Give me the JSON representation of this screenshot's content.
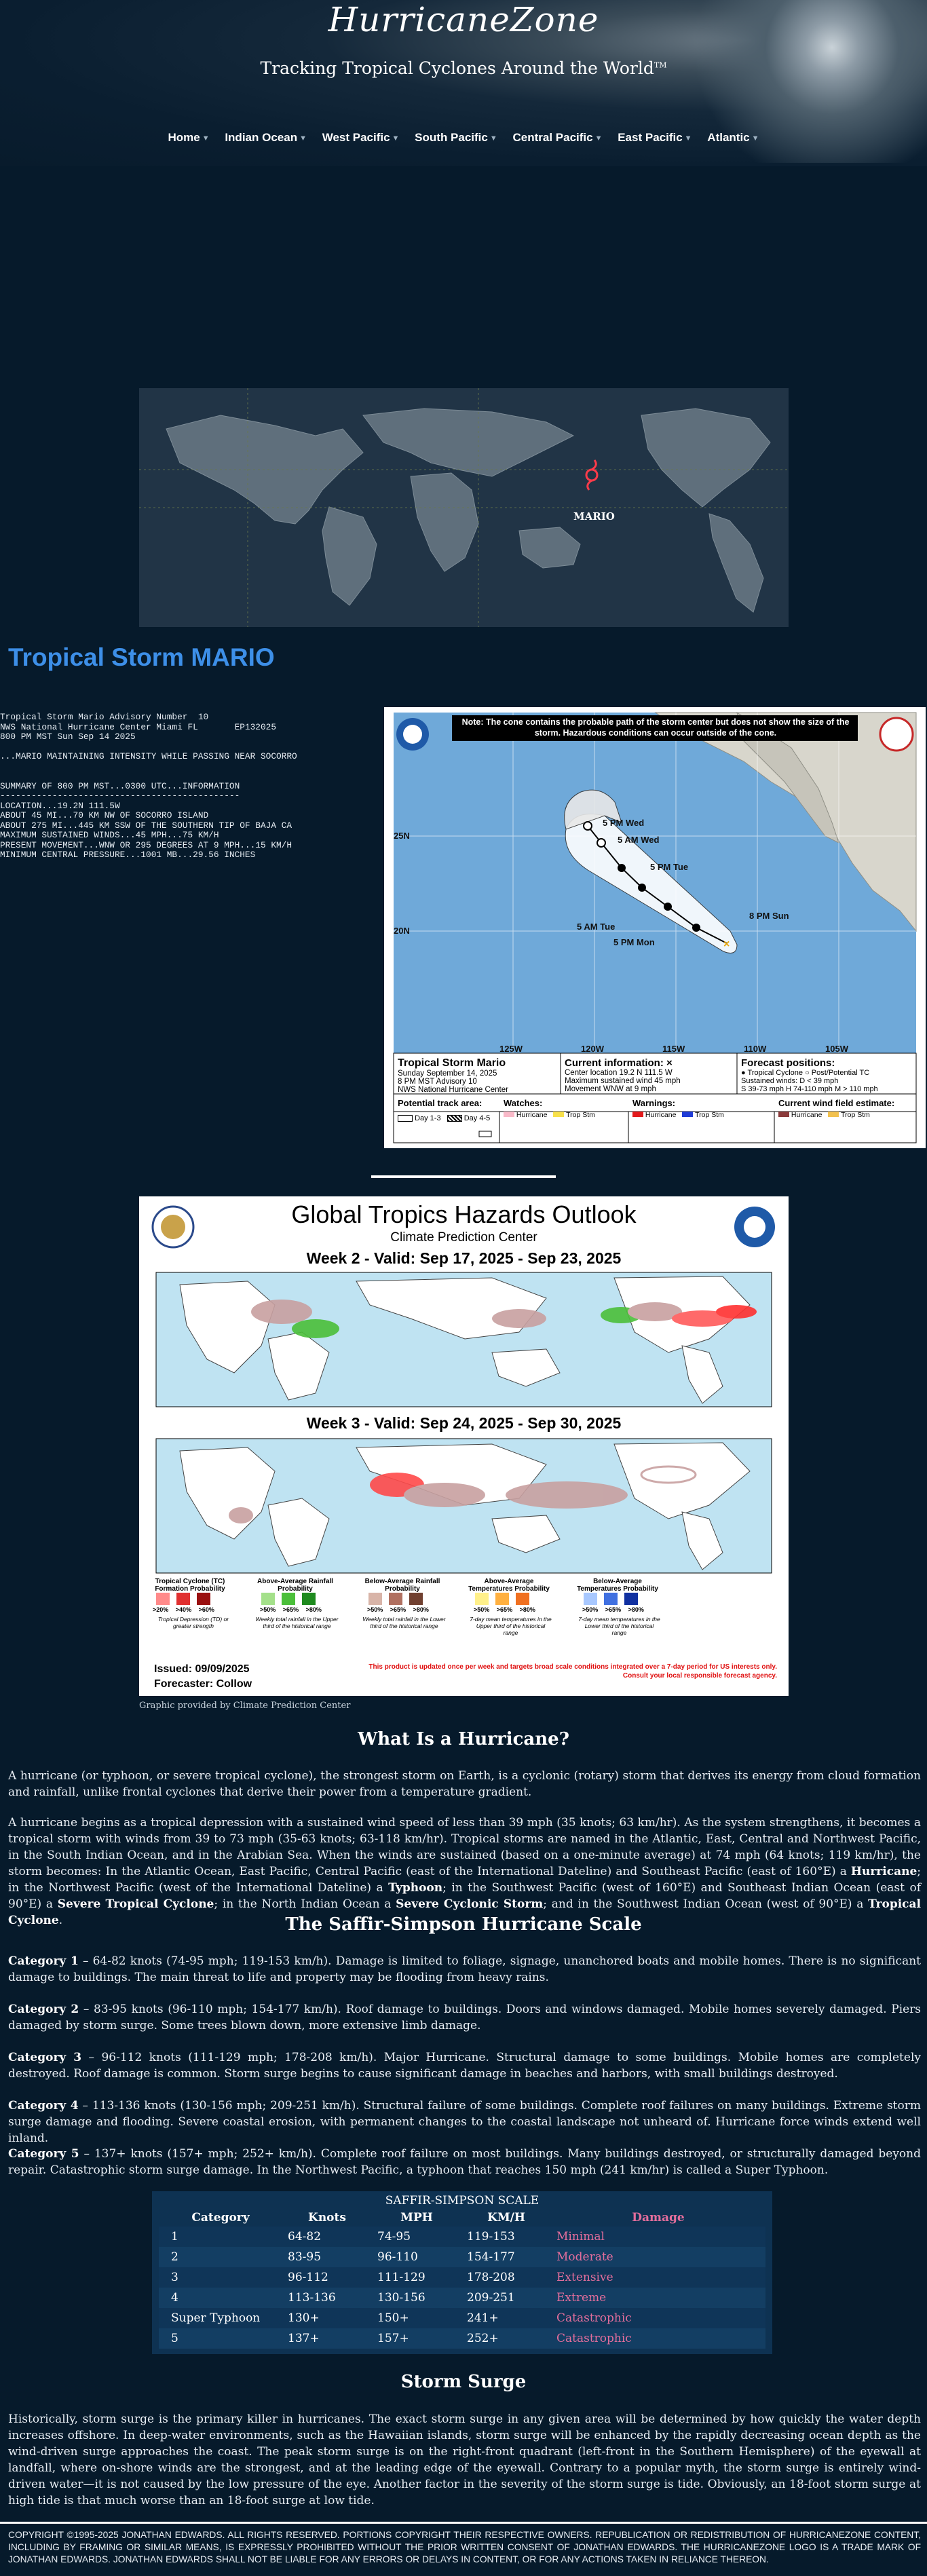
{
  "header": {
    "site_title": "HurricaneZone",
    "tagline": "Tracking Tropical Cyclones Around the World",
    "tagline_mark": "TM",
    "nav": [
      "Home",
      "Indian Ocean",
      "West Pacific",
      "South Pacific",
      "Central Pacific",
      "East Pacific",
      "Atlantic"
    ]
  },
  "world_map": {
    "storm_label": "MARIO"
  },
  "storm": {
    "title": "Tropical Storm MARIO",
    "advisory_text": "Tropical Storm Mario Advisory Number  10\nNWS National Hurricane Center Miami FL       EP132025\n800 PM MST Sun Sep 14 2025\n\n...MARIO MAINTAINING INTENSITY WHILE PASSING NEAR SOCORRO\n\n\nSUMMARY OF 800 PM MST...0300 UTC...INFORMATION\n----------------------------------------------\nLOCATION...19.2N 111.5W\nABOUT 45 MI...70 KM NW OF SOCORRO ISLAND\nABOUT 275 MI...445 KM SSW OF THE SOUTHERN TIP OF BAJA CA\nMAXIMUM SUSTAINED WINDS...45 MPH...75 KM/H\nPRESENT MOVEMENT...WNW OR 295 DEGREES AT 9 MPH...15 KM/H\nMINIMUM CENTRAL PRESSURE...1001 MB...29.56 INCHES"
  },
  "cone": {
    "note": "Note: The cone contains the probable path of the storm center but does not show the size of the storm. Hazardous conditions can occur outside of the cone.",
    "forecast_labels": [
      "5 PM Wed",
      "5 AM Wed",
      "5 PM Tue",
      "5 AM Tue",
      "5 PM Mon",
      "8 PM Sun"
    ],
    "lat_labels": [
      "25N",
      "20N"
    ],
    "lon_labels": [
      "125W",
      "120W",
      "115W",
      "110W",
      "105W"
    ],
    "storm_name": "Tropical Storm Mario",
    "date_line": "Sunday September 14, 2025",
    "advisory_line": "8 PM MST Advisory 10",
    "center_line": "NWS National Hurricane Center",
    "current_info_title": "Current information: ×",
    "current_info_lines": [
      "Center location 19.2 N 111.5 W",
      "Maximum sustained wind 45 mph",
      "Movement WNW at 9 mph"
    ],
    "forecast_positions_title": "Forecast positions:",
    "forecast_positions_lines": [
      "● Tropical Cyclone  ○ Post/Potential TC",
      "Sustained winds:      D < 39 mph",
      "S 39-73 mph  H 74-110 mph  M > 110 mph"
    ],
    "track_area_title": "Potential track area:",
    "track_area_items": [
      "Day 1-3",
      "Day 4-5"
    ],
    "watches_title": "Watches:",
    "watches_items": [
      "Hurricane",
      "Trop Stm"
    ],
    "warnings_title": "Warnings:",
    "warnings_items": [
      "Hurricane",
      "Trop Stm"
    ],
    "wind_field_title": "Current wind field estimate:",
    "wind_field_items": [
      "Hurricane",
      "Trop Stm"
    ]
  },
  "hazards": {
    "title": "Global Tropics Hazards Outlook",
    "subtitle": "Climate Prediction Center",
    "week2": "Week 2 - Valid: Sep 17, 2025 - Sep 23, 2025",
    "week3": "Week 3 - Valid: Sep 24, 2025 - Sep 30, 2025",
    "legend": [
      {
        "title": "Tropical Cyclone (TC) Formation Probability",
        "levels": [
          ">20%",
          ">40%",
          ">60%"
        ],
        "note": "Tropical Depression (TD) or greater strength"
      },
      {
        "title": "Above-Average Rainfall Probability",
        "levels": [
          ">50%",
          ">65%",
          ">80%"
        ],
        "note": "Weekly total rainfall in the Upper third of the historical range"
      },
      {
        "title": "Below-Average Rainfall Probability",
        "levels": [
          ">50%",
          ">65%",
          ">80%"
        ],
        "note": "Weekly total rainfall in the Lower third of the historical range"
      },
      {
        "title": "Above-Average Temperatures Probability",
        "levels": [
          ">50%",
          ">65%",
          ">80%"
        ],
        "note": "7-day mean temperatures in the Upper third of the historical range"
      },
      {
        "title": "Below-Average Temperatures Probability",
        "levels": [
          ">50%",
          ">65%",
          ">80%"
        ],
        "note": "7-day mean temperatures in the Lower third of the historical range"
      }
    ],
    "issued": "Issued: 09/09/2025",
    "forecaster": "Forecaster: Collow",
    "disclaimer_1": "This product is updated once per week and targets broad scale conditions integrated over a 7-day period for US interests only.",
    "disclaimer_2": "Consult your local responsible forecast agency.",
    "credit": "Graphic provided by Climate Prediction Center"
  },
  "article": {
    "what_title": "What Is a Hurricane?",
    "what_p1": "A hurricane (or typhoon, or severe tropical cyclone), the strongest storm on Earth, is a cyclonic (rotary) storm that derives its energy from cloud formation and rainfall, unlike frontal cyclones that derive their power from a temperature gradient.",
    "what_p2_a": "A hurricane begins as a tropical depression with a sustained wind speed of less than 39 mph (35 knots; 63 km/hr). As the system strengthens, it becomes a tropical storm with winds from 39 to 73 mph (35-63 knots; 63-118 km/hr). Tropical storms are named in the Atlantic, East, Central and Northwest Pacific, in the South Indian Ocean, and in the Arabian Sea. When the winds are sustained (based on a one-minute average) at 74 mph (64 knots; 119 km/hr), the storm becomes: In the Atlantic Ocean, East Pacific, Central Pacific (east of the International Dateline) and Southeast Pacific (east of 160°E) a",
    "what_p2_b1": "Hurricane",
    "what_p2_c": "; in the Northwest Pacific (west of the International Dateline) a",
    "what_p2_b2": "Typhoon",
    "what_p2_d": "; in the Southwest Pacific (west of 160°E) and Southeast Indian Ocean (east of 90°E) a",
    "what_p2_b3": "Severe Tropical Cyclone",
    "what_p2_e": "; in the North Indian Ocean a",
    "what_p2_b4": "Severe Cyclonic Storm",
    "what_p2_f": "; and in the Southwest Indian Ocean (west of 90°E) a",
    "what_p2_b5": "Tropical Cyclone",
    "what_p2_g": ".",
    "ss_title": "The Saffir-Simpson Hurricane Scale",
    "categories": [
      {
        "label": "Category 1",
        "text": " – 64-82 knots (74-95 mph; 119-153 km/h). Damage is limited to foliage, signage, unanchored boats and mobile homes. There is no significant damage to buildings. The main threat to life and property may be flooding from heavy rains."
      },
      {
        "label": "Category 2",
        "text": " – 83-95 knots (96-110 mph; 154-177 km/h). Roof damage to buildings. Doors and windows damaged. Mobile homes severely damaged. Piers damaged by storm surge. Some trees blown down, more extensive limb damage."
      },
      {
        "label": "Category 3",
        "text": " – 96-112 knots (111-129 mph; 178-208 km/h). Major Hurricane. Structural damage to some buildings. Mobile homes are completely destroyed. Roof damage is common. Storm surge begins to cause significant damage in beaches and harbors, with small buildings destroyed."
      },
      {
        "label": "Category 4",
        "text": " – 113-136 knots (130-156 mph; 209-251 km/h). Structural failure of some buildings. Complete roof failures on many buildings. Extreme storm surge damage and flooding. Severe coastal erosion, with permanent changes to the coastal landscape not unheard of. Hurricane force winds extend well inland."
      },
      {
        "label": "Category 5",
        "text": " – 137+ knots (157+ mph; 252+ km/h). Complete roof failure on most buildings. Many buildings destroyed, or structurally damaged beyond repair. Catastrophic storm surge damage. In the Northwest Pacific, a typhoon that reaches 150 mph (241 km/hr) is called a Super Typhoon."
      }
    ],
    "table": {
      "caption": "SAFFIR-SIMPSON SCALE",
      "headers": [
        "Category",
        "Knots",
        "MPH",
        "KM/H",
        "Damage"
      ],
      "rows": [
        [
          "1",
          "64-82",
          "74-95",
          "119-153",
          "Minimal"
        ],
        [
          "2",
          "83-95",
          "96-110",
          "154-177",
          "Moderate"
        ],
        [
          "3",
          "96-112",
          "111-129",
          "178-208",
          "Extensive"
        ],
        [
          "4",
          "113-136",
          "130-156",
          "209-251",
          "Extreme"
        ],
        [
          "Super Typhoon",
          "130+",
          "150+",
          "241+",
          "Catastrophic"
        ],
        [
          "5",
          "137+",
          "157+",
          "252+",
          "Catastrophic"
        ]
      ]
    },
    "surge_title": "Storm Surge",
    "surge_p": "Historically, storm surge is the primary killer in hurricanes. The exact storm surge in any given area will be determined by how quickly the water depth increases offshore. In deep-water environments, such as the Hawaiian islands, storm surge will be enhanced by the rapidly decreasing ocean depth as the wind-driven surge approaches the coast. The peak storm surge is on the right-front quadrant (left-front in the Southern Hemisphere) of the eyewall at landfall, where on-shore winds are the strongest, and at the leading edge of the eyewall. Contrary to a popular myth, the storm surge is entirely wind-driven water—it is not caused by the low pressure of the eye. Another factor in the severity of the storm surge is tide. Obviously, an 18-foot storm surge at high tide is that much worse than an 18-foot surge at low tide."
  },
  "footer": {
    "text": "COPYRIGHT ©1995-2025 JONATHAN EDWARDS. ALL RIGHTS RESERVED. PORTIONS COPYRIGHT THEIR RESPECTIVE OWNERS. REPUBLICATION OR REDISTRIBUTION OF HURRICANEZONE CONTENT, INCLUDING BY FRAMING OR SIMILAR MEANS, IS EXPRESSLY PROHIBITED WITHOUT THE PRIOR WRITTEN CONSENT OF JONATHAN EDWARDS. THE HURRICANEZONE LOGO IS A TRADE MARK OF JONATHAN EDWARDS. JONATHAN EDWARDS SHALL NOT BE LIABLE FOR ANY ERRORS OR DELAYS IN CONTENT, OR FOR ANY ACTIONS TAKEN IN RELIANCE THEREON."
  }
}
